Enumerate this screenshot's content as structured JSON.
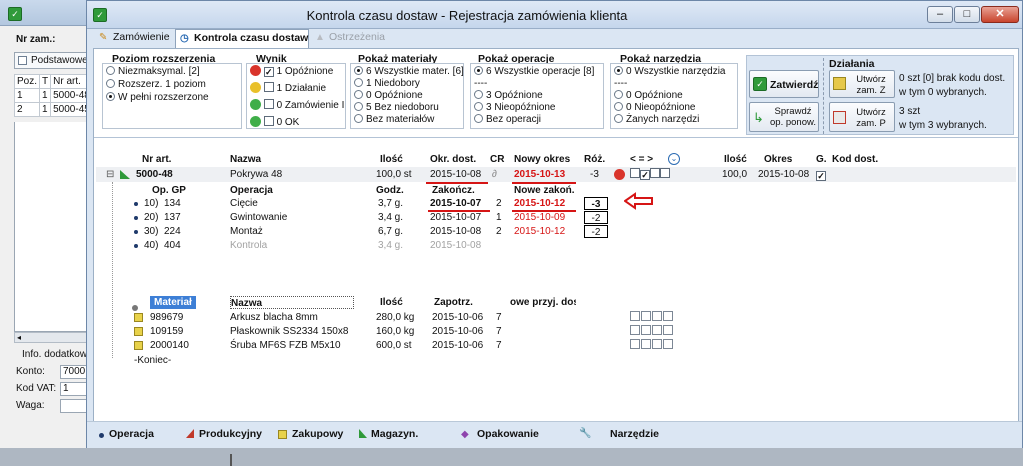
{
  "background_window": {
    "order_label": "Nr zam.:",
    "tab_label": "Podstawowe",
    "columns": [
      "Poz.",
      "T",
      "Nr art."
    ],
    "rows": [
      [
        "1",
        "1",
        "5000-48"
      ],
      [
        "2",
        "1",
        "5000-45"
      ]
    ],
    "info_label": "Info. dodatkowe",
    "konto_label": "Konto:",
    "konto_value": "7000",
    "vat_label": "Kod VAT:",
    "vat_value": "1",
    "waga_label": "Waga:"
  },
  "window": {
    "title": "Kontrola czasu dostaw - Rejestracja zamówienia klienta",
    "minimize": "–",
    "maximize": "□",
    "close": "✕"
  },
  "tabs": [
    {
      "label": "Zamówienie",
      "icon": "pencil-icon"
    },
    {
      "label": "Kontrola czasu dostaw",
      "icon": "clock-icon"
    },
    {
      "label": "Ostrzeżenia",
      "icon": "warning-icon"
    }
  ],
  "filters": {
    "poziom": {
      "title": "Poziom rozszerzenia",
      "options": [
        "Niezmaksymal. [2]",
        "Rozszerz. 1 poziom",
        "W pełni rozszerzone"
      ],
      "selected": 2
    },
    "wynik": {
      "title": "Wynik",
      "options": [
        "1 Opóźnione",
        "1 Działanie",
        "0 Zamówienie I",
        "0 OK"
      ],
      "checked": [
        true,
        false,
        false,
        false
      ],
      "colors": [
        "#d9342b",
        "#e9c02a",
        "#3fae49",
        "#3fae49"
      ]
    },
    "materialy": {
      "title": "Pokaż materiały",
      "options": [
        "6 Wszystkie mater. [6]",
        "1 Niedobory",
        "0 Opóźnione",
        "5 Bez niedoboru",
        "Bez materiałów"
      ],
      "selected": 0
    },
    "operacje": {
      "title": "Pokaż operacje",
      "options": [
        "6 Wszystkie operacje [8]",
        "----",
        "3 Opóźnione",
        "3 Nieopóźnione",
        "Bez operacji"
      ],
      "selected": 0
    },
    "narzedzia": {
      "title": "Pokaż narzędzia",
      "options": [
        "0 Wszystkie narzędzia",
        "----",
        "0 Opóźnione",
        "0 Nieopóźnione",
        "Żanych narzędzi"
      ],
      "selected": 0
    }
  },
  "actions": {
    "zatwierdz": "Zatwierdź",
    "sprawdz": "Sprawdź op. ponow.",
    "dzialania_title": "Działania",
    "utworz_z": "Utwórz zam. Z",
    "utworz_z_info1": "0 szt [0] brak kodu dost.",
    "utworz_z_info2": "w tym 0 wybranych.",
    "utworz_p": "Utwórz zam. P",
    "utworz_p_info1": "3 szt",
    "utworz_p_info2": "w tym 3 wybranych."
  },
  "grid": {
    "headers": {
      "nr": "Nr art.",
      "nazwa": "Nazwa",
      "ilosc": "Ilość",
      "okr": "Okr. dost.",
      "cr": "CR",
      "nowy": "Nowy okres",
      "roz": "Róż.",
      "cmp": "< = >",
      "ilosc2": "Ilość",
      "okres": "Okres",
      "g": "G.",
      "kod": "Kod dost."
    },
    "main_row": {
      "expand": "⊟",
      "nr": "5000-48",
      "nazwa": "Pokrywa 48",
      "ilosc": "100,0 st",
      "okr": "2015-10-08",
      "cr": "∂",
      "nowy": "2015-10-13",
      "roz": "-3",
      "ilosc2": "100,0",
      "okres": "2015-10-08"
    },
    "op_headers": {
      "op": "Op. GP",
      "operacja": "Operacja",
      "godz": "Godz.",
      "zakoncz": "Zakończ.",
      "nowe": "Nowe zakoń."
    },
    "operations": [
      {
        "nr": "10)",
        "gp": "134",
        "name": "Cięcie",
        "godz": "3,7 g.",
        "zak": "2015-10-07",
        "cr": "2",
        "nowe": "2015-10-12",
        "roz": "-3"
      },
      {
        "nr": "20)",
        "gp": "137",
        "name": "Gwintowanie",
        "godz": "3,4 g.",
        "zak": "2015-10-07",
        "cr": "1",
        "nowe": "2015-10-09",
        "roz": "-2"
      },
      {
        "nr": "30)",
        "gp": "224",
        "name": "Montaż",
        "godz": "6,7 g.",
        "zak": "2015-10-08",
        "cr": "2",
        "nowe": "2015-10-12",
        "roz": "-2"
      },
      {
        "nr": "40)",
        "gp": "404",
        "name": "Kontrola",
        "godz": "3,4 g.",
        "zak": "2015-10-08",
        "cr": "",
        "nowe": "",
        "roz": ""
      }
    ],
    "mat_headers": {
      "material": "Materiał",
      "nazwa": "Nazwa",
      "ilosc": "Ilość",
      "zapotrz": "Zapotrz.",
      "nowe": "owe przyj. dos"
    },
    "materials": [
      {
        "nr": "989679",
        "name": "Arkusz blacha 8mm",
        "ilosc": "280,0 kg",
        "zap": "2015-10-06",
        "cr": "7"
      },
      {
        "nr": "109159",
        "name": "Płaskownik SS2334 150x8",
        "ilosc": "160,0 kg",
        "zap": "2015-10-06",
        "cr": "7"
      },
      {
        "nr": "2000140",
        "name": "Śruba MF6S FZB M5x10",
        "ilosc": "600,0 st",
        "zap": "2015-10-06",
        "cr": "7"
      }
    ],
    "end_label": "-Koniec-"
  },
  "legend": {
    "operacja": "Operacja",
    "produkcyjny": "Produkcyjny",
    "zakupowy": "Zakupowy",
    "magazyn": "Magazyn.",
    "opakowanie": "Opakowanie",
    "narzedzie": "Narzędzie"
  },
  "colors": {
    "delay_red": "#d61515",
    "accent": "#2f9a3a"
  }
}
